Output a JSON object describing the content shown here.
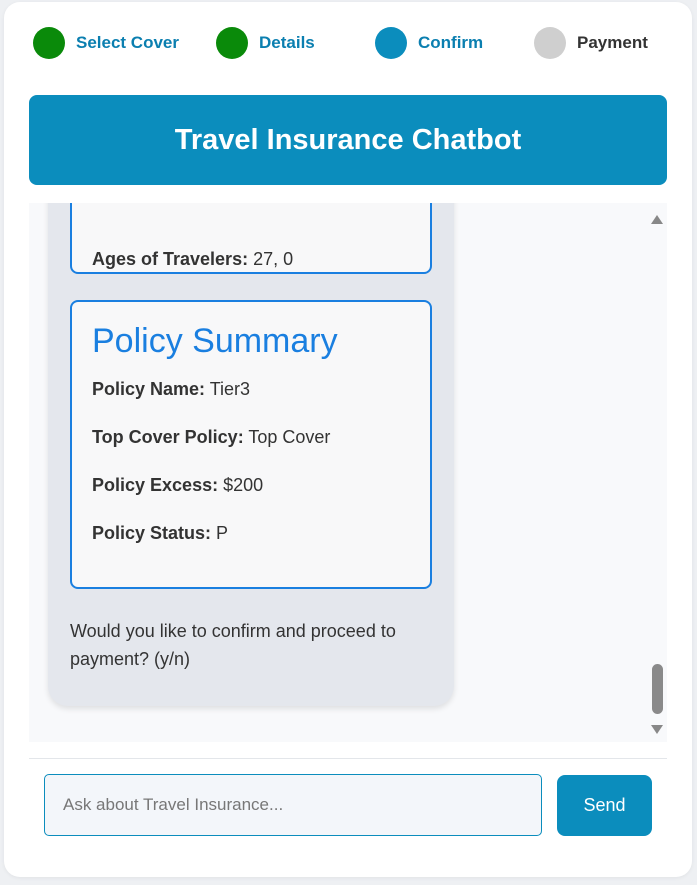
{
  "stepper": {
    "steps": [
      {
        "label": "Select Cover",
        "state": "complete",
        "color": "#0a8a0a"
      },
      {
        "label": "Details",
        "state": "complete",
        "color": "#0a8a0a"
      },
      {
        "label": "Confirm",
        "state": "active",
        "color": "#0b8dbd"
      },
      {
        "label": "Payment",
        "state": "pending",
        "color": "#cfcfcf"
      }
    ]
  },
  "header": {
    "title": "Travel Insurance Chatbot",
    "color": "#0b8dbd"
  },
  "chat": {
    "message": {
      "travelers_card": {
        "ages_label": "Ages of Travelers:",
        "ages_value": " 27, 0"
      },
      "policy_card": {
        "title": "Policy Summary",
        "fields": [
          {
            "label": "Policy Name:",
            "value": " Tier3"
          },
          {
            "label": "Top Cover Policy:",
            "value": " Top Cover"
          },
          {
            "label": "Policy Excess:",
            "value": " $200"
          },
          {
            "label": "Policy Status:",
            "value": " P"
          }
        ]
      },
      "question": "Would you like to confirm and proceed to payment? (y/n)"
    }
  },
  "input": {
    "placeholder": "Ask about Travel Insurance...",
    "value": "",
    "send_label": "Send"
  },
  "colors": {
    "accent": "#0b8dbd",
    "complete": "#0a8a0a",
    "card_border": "#1a7fe0"
  }
}
